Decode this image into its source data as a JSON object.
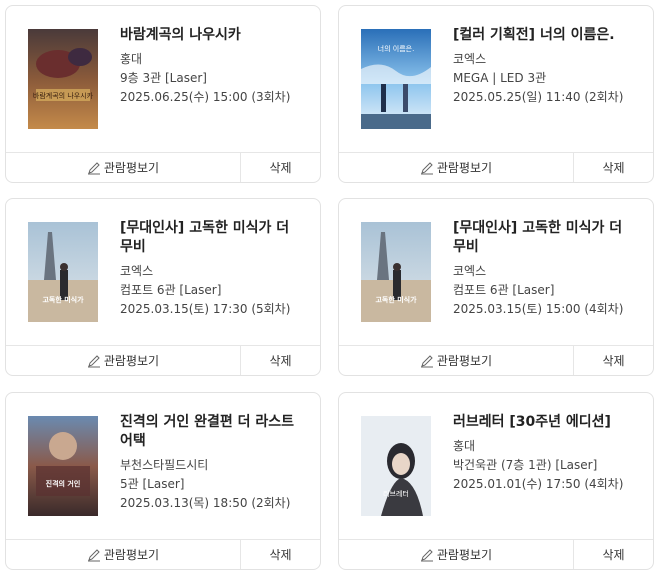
{
  "review_label": "관람평보기",
  "delete_label": "삭제",
  "bookings": [
    {
      "title": "바람계곡의 나우시카",
      "theater": "홍대",
      "screen": "9층 3관 [Laser]",
      "datetime": "2025.06.25(수) 15:00 (3회차)",
      "poster_text": "바람계곡의 나우시카"
    },
    {
      "title": "[컬러 기획전] 너의 이름은.",
      "theater": "코엑스",
      "screen": "MEGA | LED 3관",
      "datetime": "2025.05.25(일) 11:40 (2회차)",
      "poster_text": "너의 이름은."
    },
    {
      "title": "[무대인사] 고독한 미식가 더 무비",
      "theater": "코엑스",
      "screen": "컴포트 6관 [Laser]",
      "datetime": "2025.03.15(토) 17:30 (5회차)",
      "poster_text": "고독한 미식가"
    },
    {
      "title": "[무대인사] 고독한 미식가 더 무비",
      "theater": "코엑스",
      "screen": "컴포트 6관 [Laser]",
      "datetime": "2025.03.15(토) 15:00 (4회차)",
      "poster_text": "고독한 미식가"
    },
    {
      "title": "진격의 거인 완결편 더 라스트 어택",
      "theater": "부천스타필드시티",
      "screen": "5관 [Laser]",
      "datetime": "2025.03.13(목) 18:50 (2회차)",
      "poster_text": "진격의 거인"
    },
    {
      "title": "러브레터 [30주년 에디션]",
      "theater": "홍대",
      "screen": "박건욱관 (7층 1관) [Laser]",
      "datetime": "2025.01.01(수) 17:50 (4회차)",
      "poster_text": "러브레터"
    }
  ]
}
